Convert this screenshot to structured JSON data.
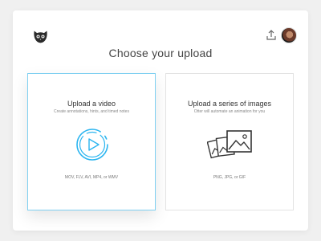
{
  "header": {
    "logo_icon": "owl-face-icon",
    "upload_icon": "upload-icon",
    "avatar_icon": "user-avatar"
  },
  "main": {
    "title": "Choose your upload",
    "cards": [
      {
        "title": "Upload a video",
        "subtitle": "Create annotations, hints, and timed notes",
        "formats": "MOV, FLV, AVI, MP4, or WMV",
        "icon": "play-circle-icon",
        "selected": true
      },
      {
        "title": "Upload a series of images",
        "subtitle": "Otter will automate an animation for you",
        "formats": "PNG, JPG, or GIF",
        "icon": "photos-icon",
        "selected": false
      }
    ]
  },
  "colors": {
    "accent": "#2bb5f0",
    "accent_border": "#7fd0f1",
    "text": "#444444",
    "muted": "#888888"
  }
}
